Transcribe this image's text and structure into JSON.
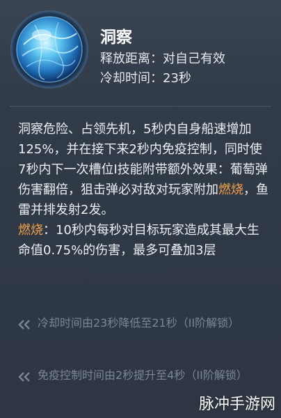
{
  "skill": {
    "name": "洞察",
    "cast_range_label": "释放距离：",
    "cast_range_value": "对自己有效",
    "cooldown_label": "冷却时间：",
    "cooldown_value": "23秒",
    "icon": "crystal-orb-icon"
  },
  "description": {
    "part1": "洞察危险、占领先机，5秒内自身船速增加125%，并在接下来2秒内免疫控制，同时使7秒内下一次槽位I技能附带额外效果：葡萄弹伤害翻倍，狙击弹必对敌对玩家附加",
    "keyword1": "燃烧",
    "part2": "，鱼雷并排发射2发。",
    "keyword2": "燃烧",
    "part3": "：10秒内每秒对目标玩家造成其最大生命值0.75%的伤害，最多可叠加3层"
  },
  "upgrades": [
    {
      "text": "冷却时间由23秒降低至21秒（II阶解锁）",
      "icon": "double-chevron-icon"
    },
    {
      "text": "免疫控制时间由2秒提升至4秒（II阶解锁）",
      "icon": "double-chevron-icon"
    }
  ],
  "watermark": "脉冲手游网",
  "colors": {
    "highlight": "#f3a14a",
    "locked_text": "#7b8693",
    "panel_bg": "#323c49"
  }
}
